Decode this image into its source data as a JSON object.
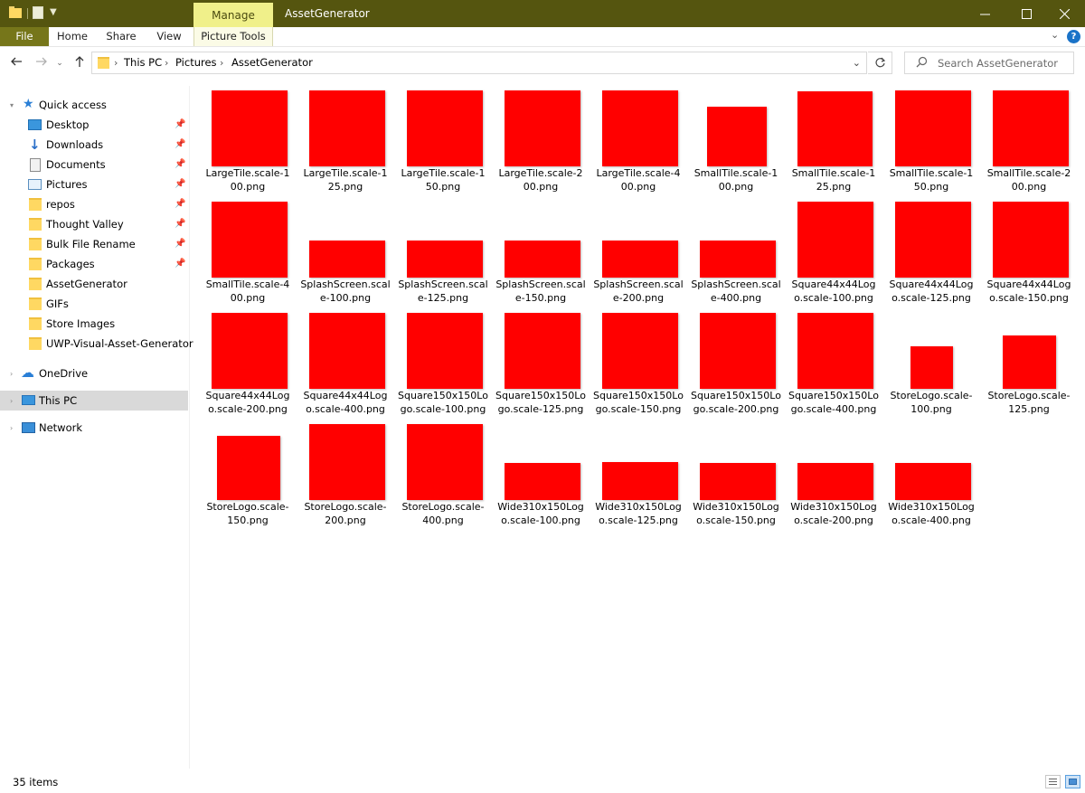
{
  "window": {
    "title": "AssetGenerator",
    "context_tab_group": "Manage"
  },
  "ribbon": {
    "tabs": [
      "File",
      "Home",
      "Share",
      "View",
      "Picture Tools"
    ]
  },
  "address": {
    "crumbs": [
      "This PC",
      "Pictures",
      "AssetGenerator"
    ]
  },
  "search": {
    "placeholder": "Search AssetGenerator"
  },
  "sidebar": {
    "quick_access": "Quick access",
    "quick_items": [
      {
        "label": "Desktop",
        "pinned": true
      },
      {
        "label": "Downloads",
        "pinned": true
      },
      {
        "label": "Documents",
        "pinned": true
      },
      {
        "label": "Pictures",
        "pinned": true
      },
      {
        "label": "repos",
        "pinned": true
      },
      {
        "label": "Thought Valley",
        "pinned": true
      },
      {
        "label": "Bulk File Rename",
        "pinned": true
      },
      {
        "label": "Packages",
        "pinned": true
      },
      {
        "label": "AssetGenerator",
        "pinned": false
      },
      {
        "label": "GIFs",
        "pinned": false
      },
      {
        "label": "Store Images",
        "pinned": false
      },
      {
        "label": "UWP-Visual-Asset-Generator",
        "pinned": false
      }
    ],
    "onedrive": "OneDrive",
    "this_pc": "This PC",
    "network": "Network"
  },
  "files": [
    {
      "line1": "LargeTile.scale-1",
      "line2": "00.png"
    },
    {
      "line1": "LargeTile.scale-1",
      "line2": "25.png"
    },
    {
      "line1": "LargeTile.scale-1",
      "line2": "50.png"
    },
    {
      "line1": "LargeTile.scale-2",
      "line2": "00.png"
    },
    {
      "line1": "LargeTile.scale-4",
      "line2": "00.png"
    },
    {
      "line1": "SmallTile.scale-1",
      "line2": "00.png"
    },
    {
      "line1": "SmallTile.scale-1",
      "line2": "25.png"
    },
    {
      "line1": "SmallTile.scale-1",
      "line2": "50.png"
    },
    {
      "line1": "SmallTile.scale-2",
      "line2": "00.png"
    },
    {
      "line1": "SmallTile.scale-4",
      "line2": "00.png"
    },
    {
      "line1": "SplashScreen.scal",
      "line2": "e-100.png"
    },
    {
      "line1": "SplashScreen.scal",
      "line2": "e-125.png"
    },
    {
      "line1": "SplashScreen.scal",
      "line2": "e-150.png"
    },
    {
      "line1": "SplashScreen.scal",
      "line2": "e-200.png"
    },
    {
      "line1": "SplashScreen.scal",
      "line2": "e-400.png"
    },
    {
      "line1": "Square44x44Log",
      "line2": "o.scale-100.png"
    },
    {
      "line1": "Square44x44Log",
      "line2": "o.scale-125.png"
    },
    {
      "line1": "Square44x44Log",
      "line2": "o.scale-150.png"
    },
    {
      "line1": "Square44x44Log",
      "line2": "o.scale-200.png"
    },
    {
      "line1": "Square44x44Log",
      "line2": "o.scale-400.png"
    },
    {
      "line1": "Square150x150Lo",
      "line2": "go.scale-100.png"
    },
    {
      "line1": "Square150x150Lo",
      "line2": "go.scale-125.png"
    },
    {
      "line1": "Square150x150Lo",
      "line2": "go.scale-150.png"
    },
    {
      "line1": "Square150x150Lo",
      "line2": "go.scale-200.png"
    },
    {
      "line1": "Square150x150Lo",
      "line2": "go.scale-400.png"
    },
    {
      "line1": "StoreLogo.scale-",
      "line2": "100.png"
    },
    {
      "line1": "StoreLogo.scale-",
      "line2": "125.png"
    },
    {
      "line1": "StoreLogo.scale-",
      "line2": "150.png"
    },
    {
      "line1": "StoreLogo.scale-",
      "line2": "200.png"
    },
    {
      "line1": "StoreLogo.scale-",
      "line2": "400.png"
    },
    {
      "line1": "Wide310x150Log",
      "line2": "o.scale-100.png"
    },
    {
      "line1": "Wide310x150Log",
      "line2": "o.scale-125.png"
    },
    {
      "line1": "Wide310x150Log",
      "line2": "o.scale-150.png"
    },
    {
      "line1": "Wide310x150Log",
      "line2": "o.scale-200.png"
    },
    {
      "line1": "Wide310x150Log",
      "line2": "o.scale-400.png"
    }
  ],
  "status": {
    "item_count": "35 items"
  },
  "colors": {
    "titlebar": "#55550f",
    "file_tab": "#76761a",
    "context_tab": "#f0f08a",
    "thumbnail": "#ff0000"
  }
}
